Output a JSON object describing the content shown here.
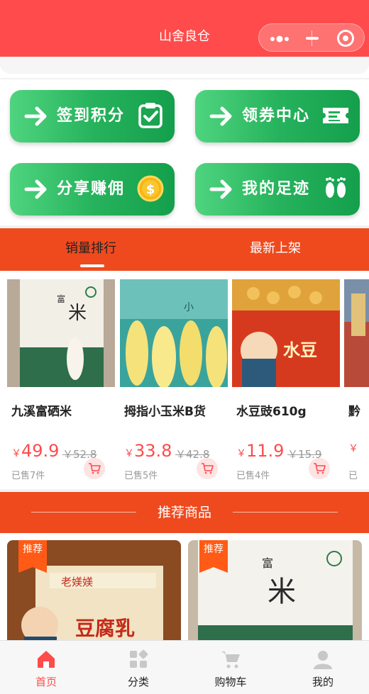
{
  "header": {
    "title": "山舍良仓"
  },
  "quick_actions": [
    {
      "label": "签到积分",
      "icon": "clipboard-check-icon"
    },
    {
      "label": "领券中心",
      "icon": "ticket-icon"
    },
    {
      "label": "分享赚佣",
      "icon": "coin-icon"
    },
    {
      "label": "我的足迹",
      "icon": "footprints-icon"
    }
  ],
  "tabs": {
    "sales": "销量排行",
    "newest": "最新上架"
  },
  "products": [
    {
      "name": "九溪富硒米",
      "price_symbol": "￥",
      "price": "49.9",
      "old_price": "￥52.8",
      "sold": "已售7件"
    },
    {
      "name": "拇指小玉米B货",
      "price_symbol": "￥",
      "price": "33.8",
      "old_price": "￥42.8",
      "sold": "已售5件"
    },
    {
      "name": "水豆豉610g",
      "price_symbol": "￥",
      "price": "11.9",
      "old_price": "￥15.9",
      "sold": "已售4件"
    },
    {
      "name": "黔",
      "price_symbol": "￥",
      "price": "",
      "old_price": "",
      "sold": "已"
    }
  ],
  "recommend": {
    "title": "推荐商品",
    "tag": "推荐"
  },
  "tabbar": [
    {
      "label": "首页",
      "icon": "home-icon",
      "active": true
    },
    {
      "label": "分类",
      "icon": "category-icon",
      "active": false
    },
    {
      "label": "购物车",
      "icon": "cart-icon",
      "active": false
    },
    {
      "label": "我的",
      "icon": "user-icon",
      "active": false
    }
  ],
  "colors": {
    "brand_red": "#ff4b4b",
    "band_orange": "#ef4a1e",
    "green_start": "#4fd47f",
    "green_end": "#149f4c"
  }
}
